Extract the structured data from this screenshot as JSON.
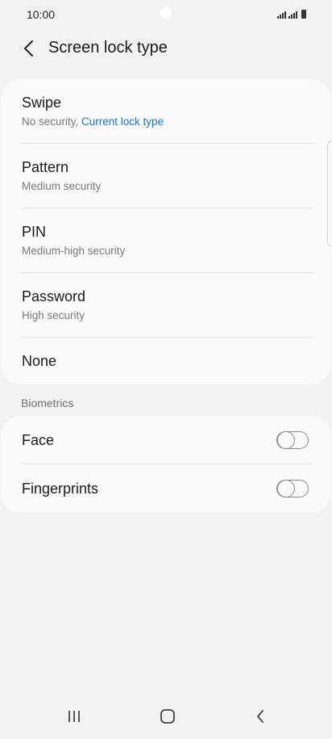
{
  "status_bar": {
    "time": "10:00"
  },
  "header": {
    "title": "Screen lock type",
    "back_icon": "chevron-left-icon"
  },
  "lock_options": [
    {
      "title": "Swipe",
      "subtitle_prefix": "No security, ",
      "subtitle_accent": "Current lock type"
    },
    {
      "title": "Pattern",
      "subtitle": "Medium security"
    },
    {
      "title": "PIN",
      "subtitle": "Medium-high security"
    },
    {
      "title": "Password",
      "subtitle": "High security"
    },
    {
      "title": "None"
    }
  ],
  "biometrics": {
    "section_label": "Biometrics",
    "items": [
      {
        "title": "Face",
        "enabled": false
      },
      {
        "title": "Fingerprints",
        "enabled": false
      }
    ]
  },
  "nav_bar": {
    "recents_icon": "recents-icon",
    "home_icon": "home-icon",
    "back_icon": "back-icon"
  },
  "colors": {
    "accent": "#1b72c0",
    "background": "#f2f2f2",
    "card": "#fafafa"
  }
}
